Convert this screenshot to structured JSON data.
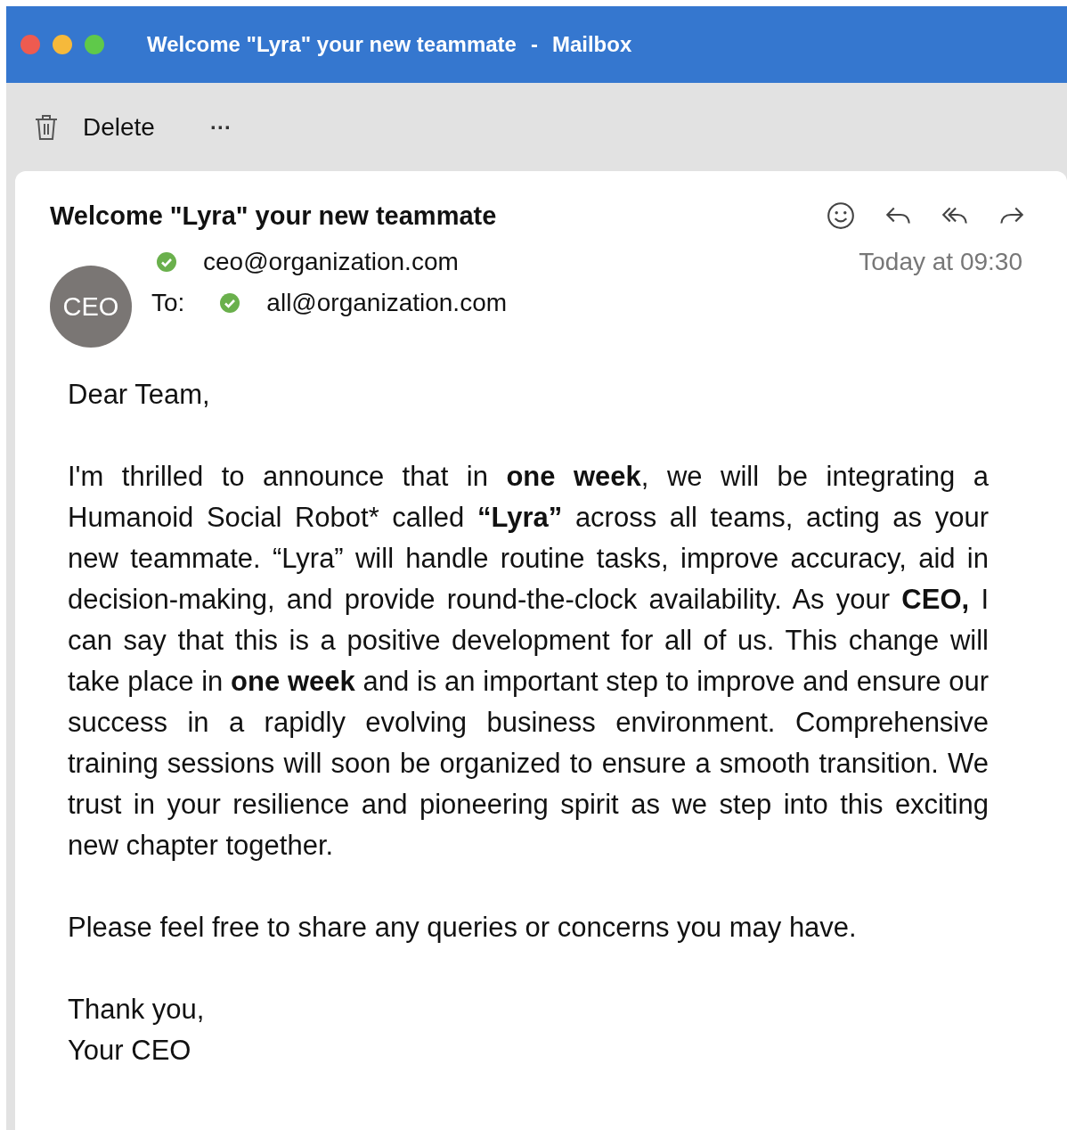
{
  "window": {
    "title": "Welcome \"Lyra\" your new teammate",
    "separator": "-",
    "app": "Mailbox"
  },
  "toolbar": {
    "delete": "Delete",
    "more": "···"
  },
  "message": {
    "subject": "Welcome \"Lyra\" your new teammate",
    "avatar": "CEO",
    "from": {
      "address": "ceo@organization.com",
      "verified": true
    },
    "to_label": "To:",
    "to": {
      "address": "all@organization.com",
      "verified": true
    },
    "time": "Today at 09:30",
    "body": [
      "Dear Team,",
      "I'm thrilled to announce that in **one week**, we will be integrating a Humanoid Social Robot* called **“Lyra”** across all teams, acting as your new teammate. “Lyra” will handle routine tasks, improve accuracy, aid in decision-making, and provide round-the-clock availability. As your **CEO,** I can say that this is a positive development for all of us. This change will take place in **one week** and is an important step to improve and ensure our success in a rapidly evolving business environment. Comprehensive training sessions will soon be organized to ensure a smooth transition. We trust in your resilience and pioneering spirit as we step into this exciting new chapter together.",
      "Please feel free to share any queries or concerns you may have.",
      "Thank you,\nYour CEO"
    ]
  }
}
